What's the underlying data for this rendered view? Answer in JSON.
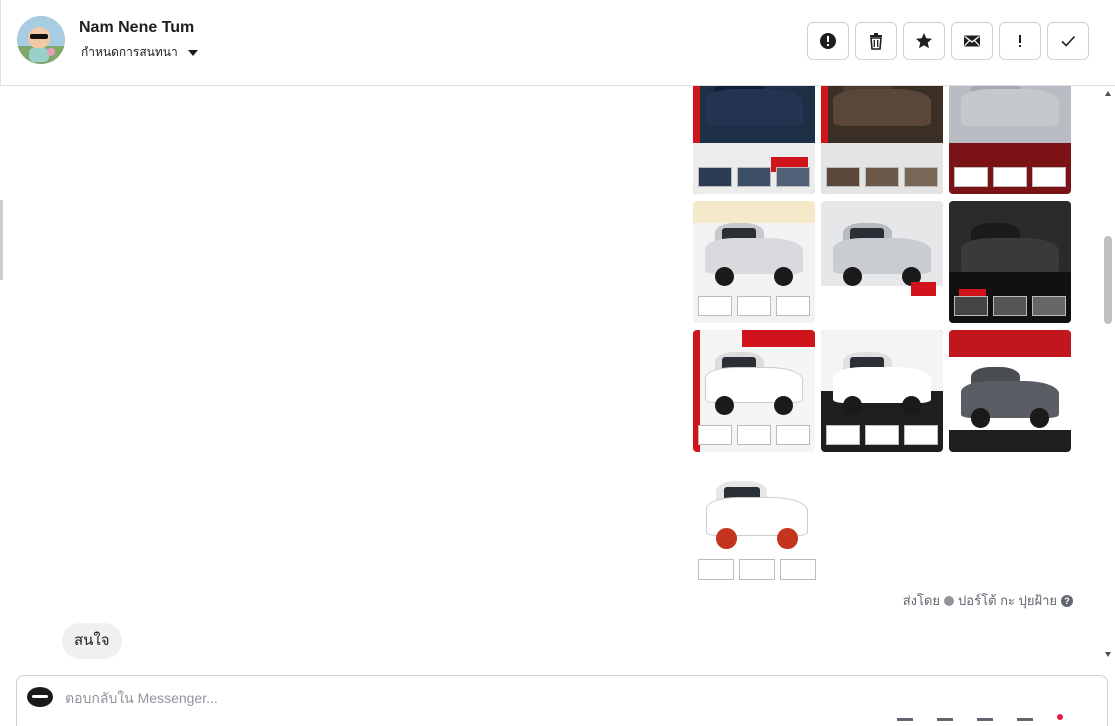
{
  "header": {
    "contact_name": "Nam Nene Tum",
    "assign_label": "กำหนดการสนทนา",
    "actions": [
      {
        "name": "spam-button",
        "icon": "alert-circle-icon"
      },
      {
        "name": "delete-button",
        "icon": "trash-icon"
      },
      {
        "name": "star-button",
        "icon": "star-icon"
      },
      {
        "name": "mark-unread-button",
        "icon": "envelope-icon"
      },
      {
        "name": "follow-up-button",
        "icon": "exclamation-icon"
      },
      {
        "name": "mark-done-button",
        "icon": "check-icon"
      }
    ]
  },
  "messages": {
    "sender_prefix": "ส่งโดย",
    "sender_name": "ปอร์โต้ กะ ปุยฝ้าย",
    "customer_reply": "สนใจ"
  },
  "composer": {
    "placeholder": "ตอบกลับใน Messenger..."
  },
  "colors": {
    "accent_red": "#d1141b",
    "border": "#ccd0d5",
    "bubble": "#f0f0f0"
  }
}
